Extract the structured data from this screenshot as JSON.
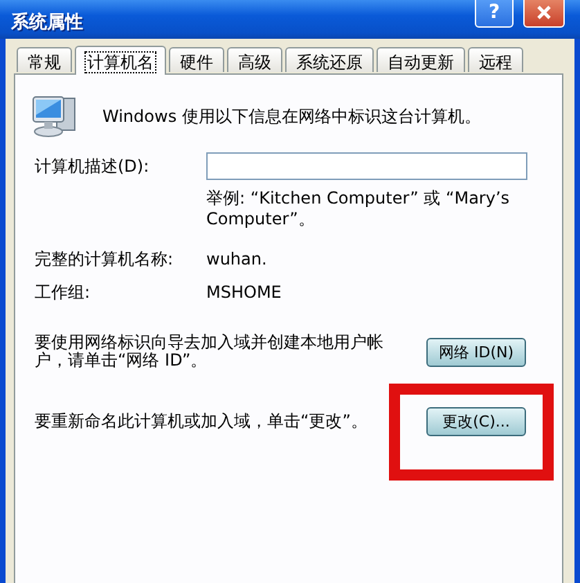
{
  "window": {
    "title": "系统属性",
    "controls": [
      {
        "kind": "help",
        "label": "?"
      },
      {
        "kind": "close"
      }
    ]
  },
  "tabs": [
    {
      "label": "常规",
      "selected": false
    },
    {
      "label": "计算机名",
      "selected": true
    },
    {
      "label": "硬件",
      "selected": false
    },
    {
      "label": "高级",
      "selected": false
    },
    {
      "label": "系统还原",
      "selected": false
    },
    {
      "label": "自动更新",
      "selected": false
    },
    {
      "label": "远程",
      "selected": false
    }
  ],
  "page": {
    "intro": "Windows 使用以下信息在网络中标识这台计算机。",
    "description_field": {
      "label": "计算机描述(D):"
    },
    "example": "举例: “Kitchen Computer” 或 “Mary’s Computer”。",
    "info": [
      {
        "label": "完整的计算机名称:",
        "value": "wuhan."
      },
      {
        "label": "工作组:",
        "value": "MSHOME"
      }
    ],
    "actions": [
      {
        "text": "要使用网络标识向导去加入域并创建本地用户帐户，请单击“网络 ID”。",
        "button": "网络 ID(N)",
        "highlighted": false
      },
      {
        "text": "要重新命名此计算机或加入域，单击“更改”。",
        "button": "更改(C)...",
        "highlighted": true
      }
    ]
  }
}
